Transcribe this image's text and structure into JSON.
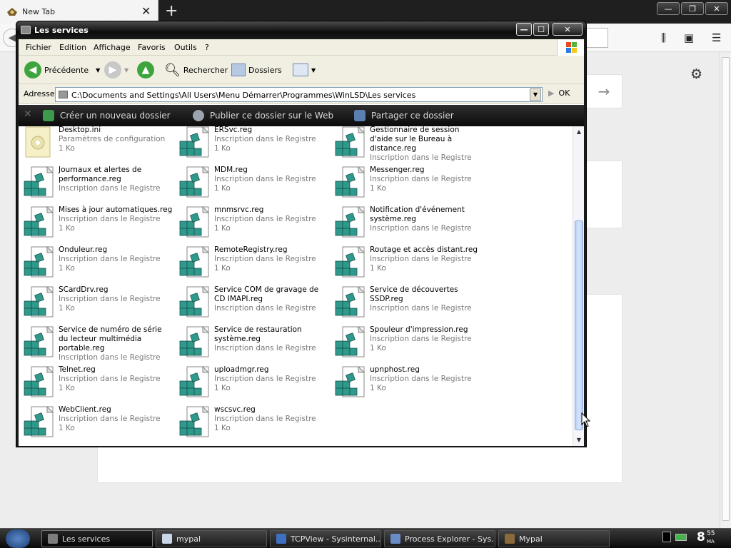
{
  "browser": {
    "tab_title": "New Tab",
    "tab_close": "✕",
    "new_tab": "+",
    "win_minimize": "—",
    "win_restore": "❐",
    "win_close": "✕",
    "forward_arrow": "→"
  },
  "window": {
    "title": "Les services",
    "cap_min": "—",
    "cap_max": "☐",
    "cap_close": "✕"
  },
  "menu": [
    "Fichier",
    "Edition",
    "Affichage",
    "Favoris",
    "Outils",
    "?"
  ],
  "toolbar": {
    "back_label": "Précédente",
    "search_label": "Rechercher",
    "folders_label": "Dossiers"
  },
  "address": {
    "label": "Adresse",
    "path": "C:\\Documents and Settings\\All Users\\Menu Démarrer\\Programmes\\WinLSD\\Les services",
    "go_label": "OK"
  },
  "tasks": {
    "new_folder": "Créer un nouveau dossier",
    "publish": "Publier ce dossier sur le Web",
    "share": "Partager ce dossier"
  },
  "files": [
    {
      "name": "Desktop.ini",
      "type": "Paramètres de configuration",
      "size": "1 Ko",
      "icon": "ini-file-icon"
    },
    {
      "name": "ERSvc.reg",
      "type": "Inscription dans le Registre",
      "size": "1 Ko",
      "icon": "registry-file-icon"
    },
    {
      "name": "Gestionnaire de session d'aide sur le Bureau à distance.reg",
      "type": "Inscription dans le Registre",
      "size": "",
      "icon": "registry-file-icon"
    },
    {
      "name": "Journaux et alertes de performance.reg",
      "type": "Inscription dans le Registre",
      "size": "",
      "icon": "registry-file-icon"
    },
    {
      "name": "MDM.reg",
      "type": "Inscription dans le Registre",
      "size": "1 Ko",
      "icon": "registry-file-icon"
    },
    {
      "name": "Messenger.reg",
      "type": "Inscription dans le Registre",
      "size": "1 Ko",
      "icon": "registry-file-icon"
    },
    {
      "name": "Mises à jour automatiques.reg",
      "type": "Inscription dans le Registre",
      "size": "1 Ko",
      "icon": "registry-file-icon"
    },
    {
      "name": "mnmsrvc.reg",
      "type": "Inscription dans le Registre",
      "size": "1 Ko",
      "icon": "registry-file-icon"
    },
    {
      "name": "Notification d'événement système.reg",
      "type": "Inscription dans le Registre",
      "size": "",
      "icon": "registry-file-icon"
    },
    {
      "name": "Onduleur.reg",
      "type": "Inscription dans le Registre",
      "size": "1 Ko",
      "icon": "registry-file-icon"
    },
    {
      "name": "RemoteRegistry.reg",
      "type": "Inscription dans le Registre",
      "size": "1 Ko",
      "icon": "registry-file-icon"
    },
    {
      "name": "Routage et accès distant.reg",
      "type": "Inscription dans le Registre",
      "size": "1 Ko",
      "icon": "registry-file-icon"
    },
    {
      "name": "SCardDrv.reg",
      "type": "Inscription dans le Registre",
      "size": "1 Ko",
      "icon": "registry-file-icon"
    },
    {
      "name": "Service COM de gravage de CD IMAPI.reg",
      "type": "Inscription dans le Registre",
      "size": "",
      "icon": "registry-file-icon"
    },
    {
      "name": "Service de découvertes SSDP.reg",
      "type": "Inscription dans le Registre",
      "size": "",
      "icon": "registry-file-icon"
    },
    {
      "name": "Service de numéro de série du lecteur multimédia portable.reg",
      "type": "Inscription dans le Registre",
      "size": "",
      "icon": "registry-file-icon"
    },
    {
      "name": "Service de restauration système.reg",
      "type": "Inscription dans le Registre",
      "size": "",
      "icon": "registry-file-icon"
    },
    {
      "name": "Spouleur d'impression.reg",
      "type": "Inscription dans le Registre",
      "size": "1 Ko",
      "icon": "registry-file-icon"
    },
    {
      "name": "Telnet.reg",
      "type": "Inscription dans le Registre",
      "size": "1 Ko",
      "icon": "registry-file-icon"
    },
    {
      "name": "uploadmgr.reg",
      "type": "Inscription dans le Registre",
      "size": "1 Ko",
      "icon": "registry-file-icon"
    },
    {
      "name": "upnphost.reg",
      "type": "Inscription dans le Registre",
      "size": "1 Ko",
      "icon": "registry-file-icon"
    },
    {
      "name": "WebClient.reg",
      "type": "Inscription dans le Registre",
      "size": "1 Ko",
      "icon": "registry-file-icon"
    },
    {
      "name": "wscsvc.reg",
      "type": "Inscription dans le Registre",
      "size": "1 Ko",
      "icon": "registry-file-icon"
    }
  ],
  "taskbar": {
    "items": [
      {
        "label": "Les services",
        "active": true
      },
      {
        "label": "mypal",
        "active": false
      },
      {
        "label": "TCPView - Sysinternal...",
        "active": false
      },
      {
        "label": "Process Explorer - Sys...",
        "active": false
      },
      {
        "label": "Mypal",
        "active": false
      }
    ],
    "clock_hour": "8",
    "clock_min": "55",
    "clock_ampm": "MA"
  },
  "colors": {
    "reg_icon_green": "#2f9a8c",
    "back_green": "#3ea53e",
    "scroll_blue": "#b9d0f7"
  }
}
